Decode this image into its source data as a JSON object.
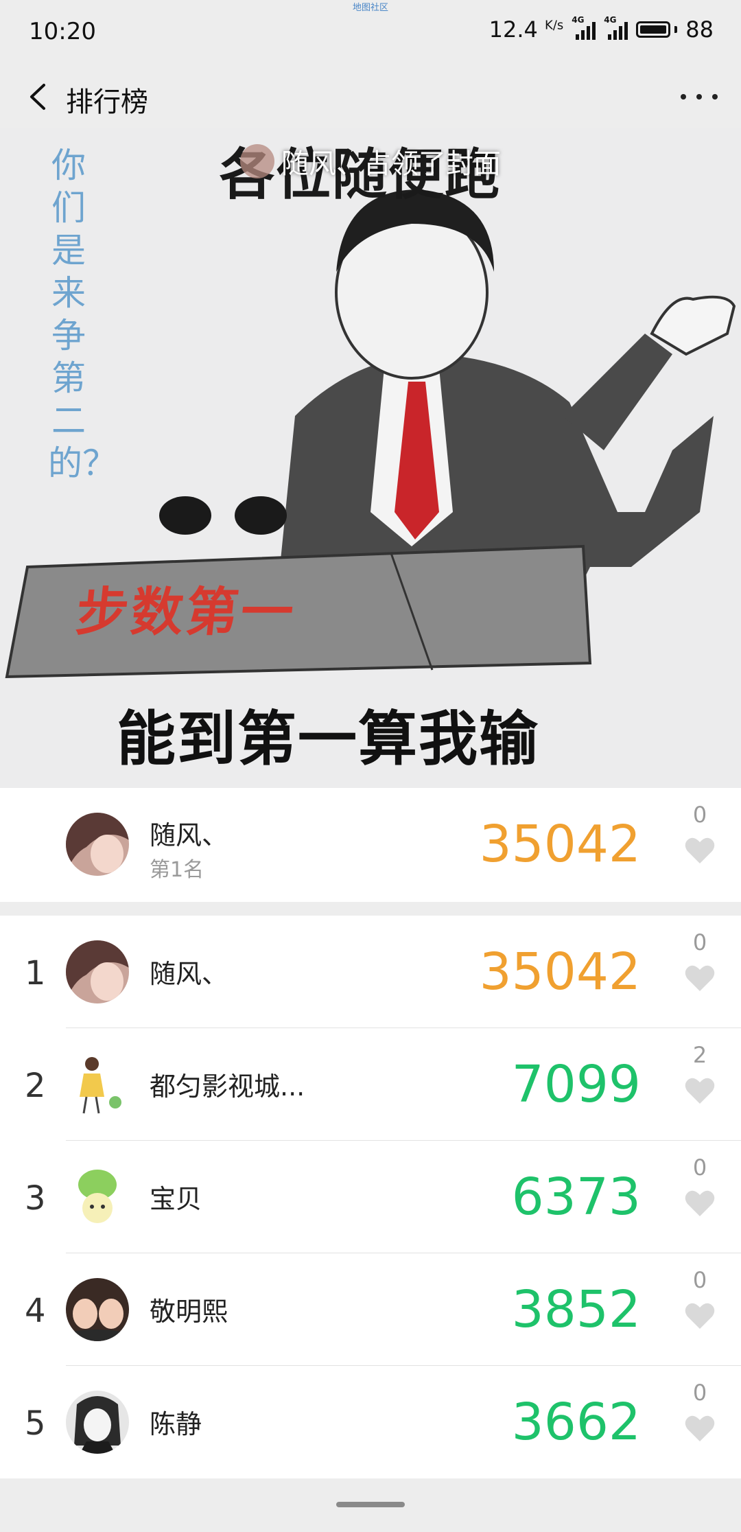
{
  "status_bar": {
    "top_tiny_text": "地图社区",
    "time": "10:20",
    "speed": "12.4",
    "speed_unit": "K/s",
    "network1": "4G",
    "network2": "4G",
    "battery": "88"
  },
  "nav": {
    "title": "排行榜",
    "back_icon": "chevron-left-icon",
    "more_icon": "more-dots-icon"
  },
  "cover": {
    "owner_name": "随风、",
    "owner_text": "随风、占领了封面",
    "meme_top": "各位随便跑",
    "meme_side": "你们是来争第二的？",
    "meme_red": "步数第一",
    "meme_bottom": "能到第一算我输"
  },
  "my_rank": {
    "name": "随风、",
    "position_label": "第1名",
    "steps": "35042",
    "likes": "0"
  },
  "leaderboard": [
    {
      "rank": "1",
      "name": "随风、",
      "steps": "35042",
      "likes": "0",
      "color": "#f0a030"
    },
    {
      "rank": "2",
      "name": "都匀影视城...",
      "steps": "7099",
      "likes": "2",
      "color": "#1ec26a"
    },
    {
      "rank": "3",
      "name": "宝贝",
      "steps": "6373",
      "likes": "0",
      "color": "#1ec26a"
    },
    {
      "rank": "4",
      "name": "敬明熙",
      "steps": "3852",
      "likes": "0",
      "color": "#1ec26a"
    },
    {
      "rank": "5",
      "name": "陈静",
      "steps": "3662",
      "likes": "0",
      "color": "#1ec26a"
    }
  ]
}
